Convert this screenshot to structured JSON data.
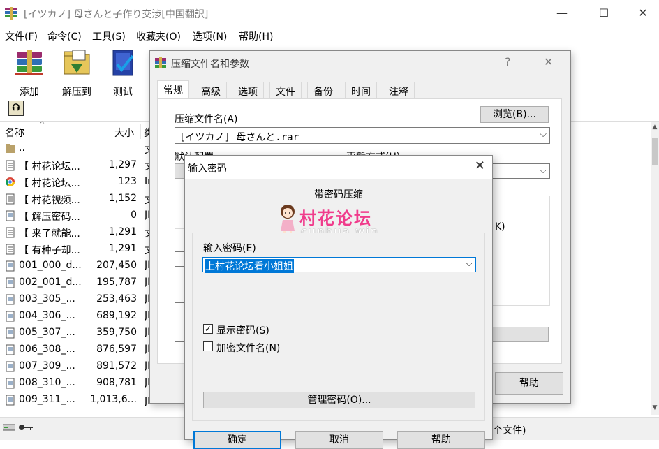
{
  "window": {
    "title": "[イツカノ] 母さんと子作り交渉[中国翻訳]",
    "minimize": "—",
    "maximize": "☐",
    "close": "✕"
  },
  "menu": [
    "文件(F)",
    "命令(C)",
    "工具(S)",
    "收藏夹(O)",
    "选项(N)",
    "帮助(H)"
  ],
  "toolbar": {
    "add": "添加",
    "extract": "解压到",
    "test": "测试"
  },
  "filelist": {
    "headers": {
      "name": "名称",
      "size": "大小",
      "type": "类"
    },
    "rows": [
      {
        "name": "..",
        "size": "",
        "type": "文",
        "icon": "folder-up-icon"
      },
      {
        "name": "【 村花论坛...",
        "size": "1,297",
        "type": "文",
        "icon": "document-icon"
      },
      {
        "name": "【 村花论坛...",
        "size": "123",
        "type": "In",
        "icon": "chrome-icon"
      },
      {
        "name": "【 村花视频...",
        "size": "1,152",
        "type": "文",
        "icon": "document-icon"
      },
      {
        "name": "【 解压密码...",
        "size": "0",
        "type": "JF",
        "icon": "image-file-icon"
      },
      {
        "name": "【 来了就能...",
        "size": "1,291",
        "type": "文",
        "icon": "document-icon"
      },
      {
        "name": "【 有种子却...",
        "size": "1,291",
        "type": "文",
        "icon": "document-icon"
      },
      {
        "name": "001_000_d...",
        "size": "207,450",
        "type": "JF",
        "icon": "image-file-icon"
      },
      {
        "name": "002_001_d...",
        "size": "195,787",
        "type": "JF",
        "icon": "image-file-icon"
      },
      {
        "name": "003_305_...",
        "size": "253,463",
        "type": "JF",
        "icon": "image-file-icon"
      },
      {
        "name": "004_306_...",
        "size": "689,192",
        "type": "JF",
        "icon": "image-file-icon"
      },
      {
        "name": "005_307_...",
        "size": "359,750",
        "type": "JF",
        "icon": "image-file-icon"
      },
      {
        "name": "006_308_...",
        "size": "876,597",
        "type": "JF",
        "icon": "image-file-icon"
      },
      {
        "name": "007_309_...",
        "size": "891,572",
        "type": "JF",
        "icon": "image-file-icon"
      },
      {
        "name": "008_310_...",
        "size": "908,781",
        "type": "JF",
        "icon": "image-file-icon"
      },
      {
        "name": "009_311_...",
        "size": "1,013,6...",
        "type": "JPG 文件",
        "icon": "image-file-icon"
      }
    ]
  },
  "status": {
    "right": "个文件)"
  },
  "archive_dialog": {
    "title": "压缩文件名和参数",
    "help_cap": "?",
    "close_cap": "✕",
    "tabs": [
      "常规",
      "高级",
      "选项",
      "文件",
      "备份",
      "时间",
      "注释"
    ],
    "archive_name_label": "压缩文件名(A)",
    "browse": "浏览(B)...",
    "archive_name_value": "[イツカノ] 母さんと.rar",
    "default_profile_label": "默认配置",
    "update_mode_label": "更新方式(U)",
    "right_edge_text": "K)",
    "help_button": "帮助"
  },
  "password_dialog": {
    "title": "输入密码",
    "close": "✕",
    "subtitle": "带密码压缩",
    "logo_text": "村花论坛",
    "logo_sub": "cunhua.win",
    "enter_label": "输入密码(E)",
    "password_value": "上村花论坛看小姐姐",
    "show_password": "显示密码(S)",
    "show_password_checked": true,
    "encrypt_names": "加密文件名(N)",
    "encrypt_names_checked": false,
    "manage": "管理密码(O)...",
    "ok": "确定",
    "cancel": "取消",
    "help": "帮助"
  }
}
